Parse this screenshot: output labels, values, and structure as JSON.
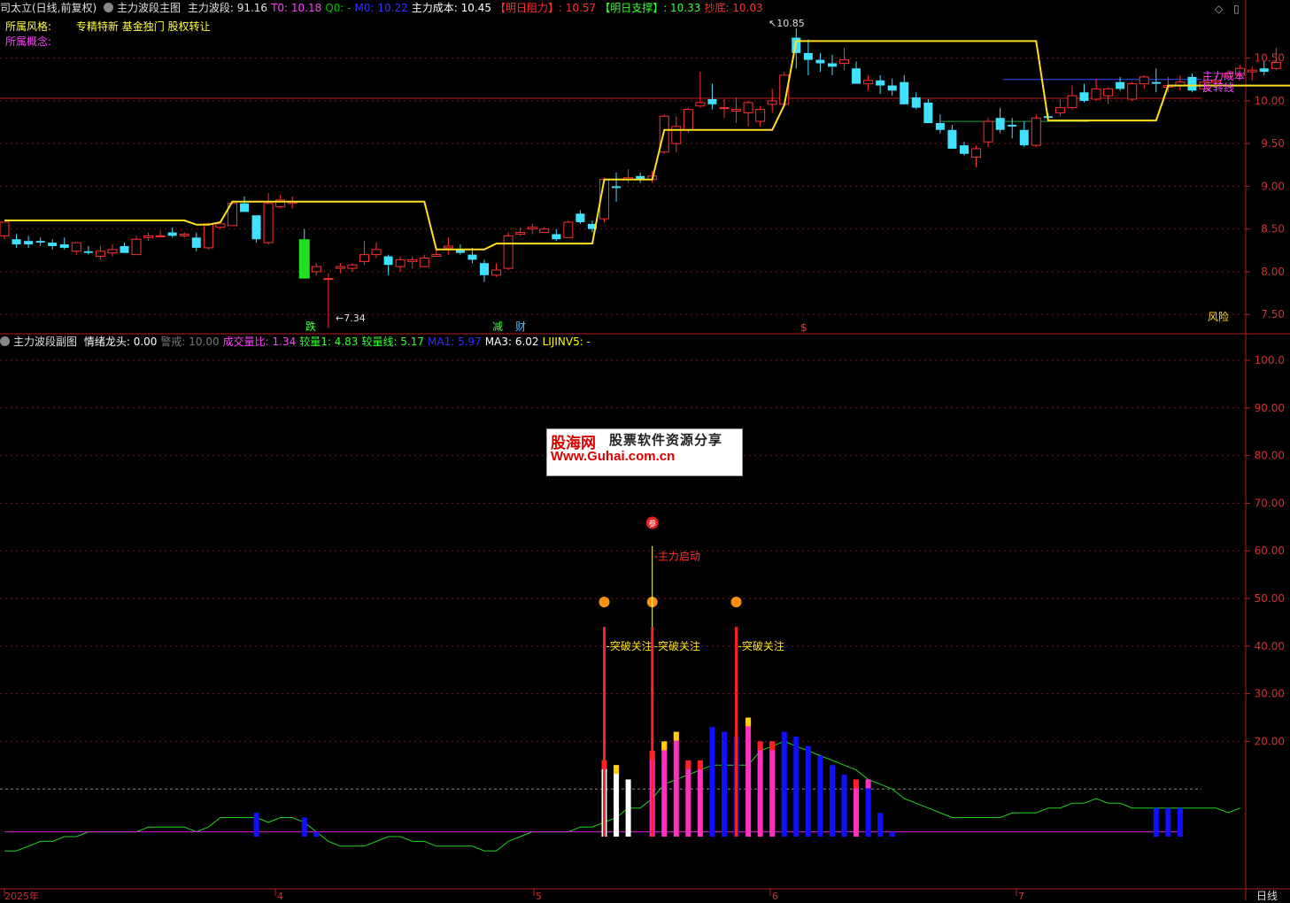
{
  "header_main": {
    "stock": "司太立(日线,前复权)",
    "indicator": "主力波段主图",
    "items": [
      {
        "label": "主力波段: 91.16",
        "color": "#e0e0e0"
      },
      {
        "label": "T0: 10.18",
        "color": "#ff40ff"
      },
      {
        "label": "Q0: -",
        "color": "#00c000"
      },
      {
        "label": "M0: 10.22",
        "color": "#3030ff"
      },
      {
        "label": "主力成本: 10.45",
        "color": "#ffffff"
      },
      {
        "label": "【明日阻力】: 10.57",
        "color": "#ff3030"
      },
      {
        "label": "【明日支撑】: 10.33",
        "color": "#30ff30"
      },
      {
        "label": "抄底: 10.03",
        "color": "#ff3030"
      }
    ]
  },
  "info": {
    "style_label": "所属风格:",
    "style_value": "专精特新 基金独门 股权转让",
    "concept_label": "所属概念:"
  },
  "header_sub": {
    "indicator": "主力波段副图",
    "items": [
      {
        "label": "情绪龙头: 0.00",
        "color": "#ffffff"
      },
      {
        "label": "警戒: 10.00",
        "color": "#777777"
      },
      {
        "label": "成交量比: 1.34",
        "color": "#ff40ff"
      },
      {
        "label": "较量1: 4.83",
        "color": "#30ff30"
      },
      {
        "label": "较量线: 5.17",
        "color": "#30ff30"
      },
      {
        "label": "MA1: 5.97",
        "color": "#3030ff"
      },
      {
        "label": "MA3: 6.02",
        "color": "#ffffff"
      },
      {
        "label": "LIJINV5: -",
        "color": "#ffff00"
      }
    ]
  },
  "price_axis": [
    "10.50",
    "10.00",
    "9.50",
    "9.00",
    "8.50",
    "8.00",
    "7.50"
  ],
  "sub_axis": [
    "100.0",
    "90.00",
    "80.00",
    "70.00",
    "60.00",
    "50.00",
    "40.00",
    "30.00",
    "20.00"
  ],
  "x_labels": [
    "2025年",
    "4",
    "5",
    "6",
    "7"
  ],
  "period": "日线",
  "annotations": {
    "high": "10.85",
    "low": "7.34",
    "cost_line": "主力成本",
    "reversal_line": "反转线",
    "risk": "风险",
    "die": "跌",
    "jian": "减",
    "cai": "财",
    "dollar": "$",
    "zhuli_qidong": "主力启动",
    "breakout": "突破关注",
    "can": "参"
  },
  "watermark": {
    "title": "股海网",
    "subtitle": "股票软件资源分享",
    "url": "Www.Guhai.com.cn"
  },
  "chart_data": {
    "type": "candlestick",
    "title": "司太立(日线,前复权)",
    "x_ticks": [
      "2025年",
      "4",
      "5",
      "6",
      "7"
    ],
    "y_range": [
      7.3,
      10.95
    ],
    "ohlc": [
      [
        8.42,
        8.58,
        8.38,
        8.58
      ],
      [
        8.38,
        8.44,
        8.28,
        8.32
      ],
      [
        8.36,
        8.42,
        8.28,
        8.32
      ],
      [
        8.36,
        8.4,
        8.3,
        8.34
      ],
      [
        8.34,
        8.38,
        8.26,
        8.3
      ],
      [
        8.32,
        8.4,
        8.26,
        8.28
      ],
      [
        8.24,
        8.34,
        8.2,
        8.34
      ],
      [
        8.24,
        8.3,
        8.2,
        8.22
      ],
      [
        8.18,
        8.3,
        8.14,
        8.24
      ],
      [
        8.22,
        8.32,
        8.18,
        8.26
      ],
      [
        8.3,
        8.34,
        8.22,
        8.22
      ],
      [
        8.2,
        8.42,
        8.2,
        8.38
      ],
      [
        8.4,
        8.46,
        8.36,
        8.42
      ],
      [
        8.42,
        8.48,
        8.4,
        8.42
      ],
      [
        8.46,
        8.52,
        8.4,
        8.42
      ],
      [
        8.42,
        8.46,
        8.4,
        8.44
      ],
      [
        8.4,
        8.46,
        8.24,
        8.28
      ],
      [
        8.28,
        8.58,
        8.26,
        8.56
      ],
      [
        8.52,
        8.6,
        8.5,
        8.56
      ],
      [
        8.54,
        8.82,
        8.54,
        8.8
      ],
      [
        8.8,
        8.88,
        8.7,
        8.7
      ],
      [
        8.66,
        8.66,
        8.34,
        8.38
      ],
      [
        8.34,
        8.92,
        8.32,
        8.8
      ],
      [
        8.76,
        8.9,
        8.74,
        8.84
      ],
      [
        8.8,
        8.88,
        8.74,
        8.82
      ],
      [
        8.38,
        8.5,
        7.92,
        7.92
      ],
      [
        8.0,
        8.1,
        7.96,
        8.06
      ],
      [
        7.92,
        7.98,
        7.34,
        7.92
      ],
      [
        8.04,
        8.1,
        7.98,
        8.06
      ],
      [
        8.04,
        8.1,
        8.0,
        8.08
      ],
      [
        8.12,
        8.36,
        8.08,
        8.2
      ],
      [
        8.2,
        8.34,
        8.16,
        8.26
      ],
      [
        8.18,
        8.2,
        7.96,
        8.08
      ],
      [
        8.06,
        8.18,
        8.0,
        8.14
      ],
      [
        8.12,
        8.18,
        8.04,
        8.14
      ],
      [
        8.06,
        8.2,
        8.06,
        8.16
      ],
      [
        8.18,
        8.26,
        8.18,
        8.2
      ],
      [
        8.28,
        8.4,
        8.2,
        8.3
      ],
      [
        8.26,
        8.32,
        8.2,
        8.22
      ],
      [
        8.2,
        8.28,
        8.1,
        8.14
      ],
      [
        8.1,
        8.14,
        7.88,
        7.96
      ],
      [
        7.96,
        8.1,
        7.94,
        8.02
      ],
      [
        8.04,
        8.46,
        8.02,
        8.42
      ],
      [
        8.44,
        8.52,
        8.42,
        8.46
      ],
      [
        8.5,
        8.56,
        8.44,
        8.52
      ],
      [
        8.46,
        8.52,
        8.46,
        8.5
      ],
      [
        8.44,
        8.5,
        8.36,
        8.38
      ],
      [
        8.4,
        8.6,
        8.4,
        8.58
      ],
      [
        8.68,
        8.72,
        8.56,
        8.58
      ],
      [
        8.56,
        8.6,
        8.46,
        8.5
      ],
      [
        8.62,
        9.1,
        8.58,
        9.08
      ],
      [
        9.0,
        9.16,
        8.82,
        8.98
      ],
      [
        9.08,
        9.2,
        9.04,
        9.1
      ],
      [
        9.12,
        9.16,
        9.04,
        9.08
      ],
      [
        9.08,
        9.18,
        9.04,
        9.12
      ],
      [
        9.4,
        9.84,
        9.38,
        9.82
      ],
      [
        9.5,
        9.82,
        9.4,
        9.7
      ],
      [
        9.66,
        9.92,
        9.62,
        9.9
      ],
      [
        9.94,
        10.34,
        9.92,
        9.98
      ],
      [
        10.02,
        10.2,
        9.9,
        9.96
      ],
      [
        9.92,
        10.02,
        9.8,
        9.92
      ],
      [
        9.88,
        10.04,
        9.74,
        9.9
      ],
      [
        9.86,
        10.0,
        9.7,
        9.98
      ],
      [
        9.76,
        9.94,
        9.7,
        9.9
      ],
      [
        9.96,
        10.14,
        9.86,
        10.0
      ],
      [
        9.96,
        10.34,
        9.94,
        10.3
      ],
      [
        10.74,
        10.85,
        10.38,
        10.56
      ],
      [
        10.56,
        10.72,
        10.3,
        10.48
      ],
      [
        10.48,
        10.56,
        10.34,
        10.44
      ],
      [
        10.44,
        10.54,
        10.3,
        10.4
      ],
      [
        10.44,
        10.62,
        10.36,
        10.48
      ],
      [
        10.38,
        10.46,
        10.2,
        10.2
      ],
      [
        10.2,
        10.3,
        10.12,
        10.24
      ],
      [
        10.24,
        10.3,
        10.08,
        10.18
      ],
      [
        10.18,
        10.26,
        10.06,
        10.12
      ],
      [
        10.22,
        10.3,
        9.96,
        9.96
      ],
      [
        10.04,
        10.1,
        9.9,
        9.92
      ],
      [
        9.98,
        10.02,
        9.74,
        9.74
      ],
      [
        9.74,
        9.84,
        9.62,
        9.66
      ],
      [
        9.66,
        9.72,
        9.44,
        9.44
      ],
      [
        9.48,
        9.52,
        9.36,
        9.38
      ],
      [
        9.34,
        9.48,
        9.22,
        9.44
      ],
      [
        9.52,
        9.8,
        9.46,
        9.76
      ],
      [
        9.8,
        9.92,
        9.62,
        9.66
      ],
      [
        9.72,
        9.8,
        9.56,
        9.7
      ],
      [
        9.66,
        9.76,
        9.46,
        9.48
      ],
      [
        9.48,
        9.84,
        9.46,
        9.8
      ],
      [
        9.82,
        9.86,
        9.78,
        9.8
      ],
      [
        9.86,
        10.02,
        9.82,
        9.92
      ],
      [
        9.92,
        10.18,
        9.9,
        10.06
      ],
      [
        10.1,
        10.2,
        9.98,
        10.0
      ],
      [
        10.02,
        10.26,
        10.0,
        10.14
      ],
      [
        10.06,
        10.16,
        9.96,
        10.14
      ],
      [
        10.22,
        10.28,
        10.12,
        10.14
      ],
      [
        10.02,
        10.22,
        10.0,
        10.2
      ],
      [
        10.2,
        10.3,
        10.14,
        10.28
      ],
      [
        10.22,
        10.38,
        10.1,
        10.2
      ],
      [
        10.16,
        10.28,
        10.1,
        10.18
      ],
      [
        10.18,
        10.3,
        10.12,
        10.22
      ],
      [
        10.28,
        10.32,
        10.1,
        10.12
      ],
      [
        10.14,
        10.3,
        10.1,
        10.22
      ],
      [
        10.22,
        10.3,
        10.2,
        10.24
      ],
      [
        10.28,
        10.36,
        10.26,
        10.32
      ],
      [
        10.3,
        10.42,
        10.28,
        10.38
      ],
      [
        10.34,
        10.4,
        10.24,
        10.36
      ],
      [
        10.38,
        10.46,
        10.3,
        10.34
      ],
      [
        10.38,
        10.62,
        10.36,
        10.45
      ]
    ],
    "band_line": [
      8.6,
      8.6,
      8.6,
      8.6,
      8.6,
      8.6,
      8.6,
      8.6,
      8.6,
      8.6,
      8.6,
      8.6,
      8.6,
      8.6,
      8.6,
      8.6,
      8.55,
      8.55,
      8.58,
      8.82,
      8.82,
      8.82,
      8.82,
      8.82,
      8.82,
      8.82,
      8.82,
      8.82,
      8.82,
      8.82,
      8.82,
      8.82,
      8.82,
      8.82,
      8.82,
      8.82,
      8.26,
      8.26,
      8.26,
      8.26,
      8.26,
      8.33,
      8.33,
      8.33,
      8.33,
      8.33,
      8.33,
      8.33,
      8.33,
      8.33,
      9.08,
      9.08,
      9.08,
      9.08,
      9.08,
      9.66,
      9.66,
      9.66,
      9.66,
      9.66,
      9.66,
      9.66,
      9.66,
      9.66,
      9.66,
      9.95,
      10.7,
      10.7,
      10.7,
      10.7,
      10.7,
      10.7,
      10.7,
      10.7,
      10.7,
      10.7,
      10.7,
      10.7,
      10.7,
      10.7,
      10.7,
      10.7,
      10.7,
      10.7,
      10.7,
      10.7,
      10.7,
      9.77,
      9.77,
      9.77,
      9.77,
      9.77,
      9.77,
      9.77,
      9.77,
      9.77,
      9.77,
      10.18,
      10.18,
      10.18,
      10.18,
      10.18,
      10.18,
      10.18,
      10.18,
      10.18,
      10.18,
      10.18,
      10.18,
      10.45
    ],
    "level_cost": 10.22,
    "level_reversal": 10.03,
    "sub_y_range": [
      0,
      105
    ],
    "sub_bars": [
      {
        "i": 21,
        "v": 5,
        "c": "#1010ff"
      },
      {
        "i": 25,
        "v": 4,
        "c": "#1010ff"
      },
      {
        "i": 26,
        "v": 1,
        "c": "#1010ff"
      },
      {
        "i": 50,
        "v": 16,
        "c": "#ffffff",
        "t": "#ff2020"
      },
      {
        "i": 51,
        "v": 15,
        "c": "#ffffff",
        "t": "#ffd000"
      },
      {
        "i": 52,
        "v": 12,
        "c": "#ffffff"
      },
      {
        "i": 54,
        "v": 18,
        "c": "#ff30c0",
        "t": "#ff2020"
      },
      {
        "i": 55,
        "v": 20,
        "c": "#ff30c0",
        "t": "#ffd000"
      },
      {
        "i": 56,
        "v": 22,
        "c": "#ff30c0",
        "t": "#ffd000"
      },
      {
        "i": 57,
        "v": 16,
        "c": "#ff30c0",
        "t": "#ff2020"
      },
      {
        "i": 58,
        "v": 16,
        "c": "#ff30c0",
        "t": "#ff2020"
      },
      {
        "i": 59,
        "v": 23,
        "c": "#1010ff"
      },
      {
        "i": 60,
        "v": 22,
        "c": "#1010ff"
      },
      {
        "i": 61,
        "v": 21,
        "c": "#1010ff"
      },
      {
        "i": 62,
        "v": 25,
        "c": "#ff30c0",
        "t": "#ffd000"
      },
      {
        "i": 63,
        "v": 20,
        "c": "#ff30c0",
        "t": "#ff2020"
      },
      {
        "i": 64,
        "v": 20,
        "c": "#ff30c0",
        "t": "#ff2020"
      },
      {
        "i": 65,
        "v": 22,
        "c": "#1010ff"
      },
      {
        "i": 66,
        "v": 21,
        "c": "#1010ff"
      },
      {
        "i": 67,
        "v": 19,
        "c": "#1010ff"
      },
      {
        "i": 68,
        "v": 17,
        "c": "#1010ff"
      },
      {
        "i": 69,
        "v": 15,
        "c": "#1010ff"
      },
      {
        "i": 70,
        "v": 13,
        "c": "#1010ff"
      },
      {
        "i": 71,
        "v": 12,
        "c": "#ff30c0",
        "t": "#ff2020"
      },
      {
        "i": 72,
        "v": 12,
        "c": "#1010ff",
        "t": "#ff30c0"
      },
      {
        "i": 73,
        "v": 5,
        "c": "#1010ff"
      },
      {
        "i": 74,
        "v": 1,
        "c": "#1010ff"
      },
      {
        "i": 96,
        "v": 6,
        "c": "#1010ff"
      },
      {
        "i": 97,
        "v": 6,
        "c": "#1010ff"
      },
      {
        "i": 98,
        "v": 6,
        "c": "#1010ff"
      }
    ],
    "spikes": [
      {
        "i": 50,
        "v": 44
      },
      {
        "i": 54,
        "v": 44
      },
      {
        "i": 61,
        "v": 44
      }
    ],
    "green_line": [
      -3,
      -3,
      -2,
      -1,
      -1,
      0,
      0,
      1,
      1,
      1,
      1,
      1,
      2,
      2,
      2,
      2,
      1,
      2,
      4,
      4,
      4,
      4,
      3,
      4,
      4,
      3,
      1,
      -1,
      -2,
      -2,
      -2,
      -1,
      0,
      0,
      -1,
      -1,
      -2,
      -2,
      -2,
      -2,
      -3,
      -3,
      -1,
      0,
      1,
      1,
      1,
      1,
      2,
      2,
      3,
      4,
      6,
      6,
      8,
      11,
      12,
      13,
      14,
      15,
      15,
      15,
      15,
      18,
      19,
      20,
      19,
      18,
      17,
      16,
      15,
      14,
      12,
      11,
      10,
      8,
      7,
      6,
      5,
      4,
      4,
      4,
      4,
      4,
      5,
      5,
      5,
      6,
      6,
      7,
      7,
      8,
      7,
      7,
      6,
      6,
      6,
      6,
      6,
      6,
      6,
      6,
      5,
      6
    ],
    "magenta_line": [
      1,
      1,
      1,
      1,
      1,
      1,
      1,
      1,
      1,
      1,
      1,
      1,
      1,
      1,
      1,
      1,
      1,
      1,
      1,
      1,
      1,
      1,
      1,
      1,
      1,
      1,
      1,
      1,
      1,
      1,
      1,
      1,
      1,
      1,
      1,
      1,
      1,
      1,
      1,
      1,
      1,
      1,
      1,
      1,
      1,
      1,
      1,
      1,
      1,
      1,
      1,
      1,
      1,
      1,
      1,
      1,
      1,
      1,
      1,
      1,
      1,
      1,
      1,
      1,
      1,
      1,
      1,
      1,
      1,
      1,
      1,
      1,
      1,
      1,
      1,
      1,
      1,
      1,
      1,
      1,
      1,
      1,
      1,
      1,
      1,
      1,
      1,
      1,
      1,
      1,
      1,
      1,
      1,
      1,
      1,
      1,
      1,
      1,
      1
    ]
  }
}
